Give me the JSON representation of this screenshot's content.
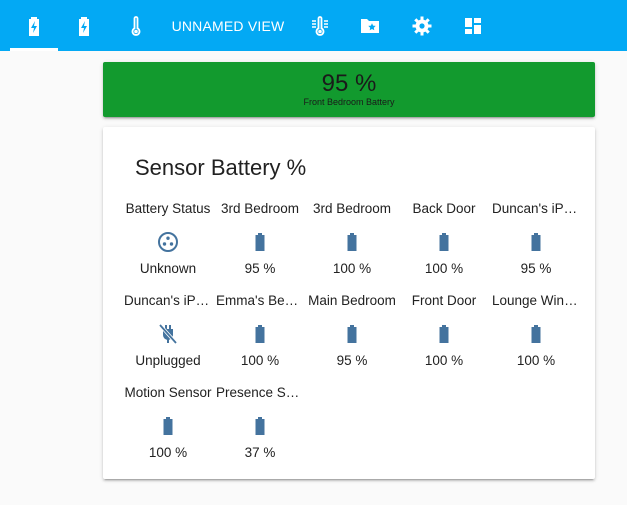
{
  "header": {
    "tabs": [
      {
        "type": "icon",
        "icon": "battery-charging-icon",
        "active": true
      },
      {
        "type": "icon",
        "icon": "battery-charging-icon-2",
        "active": false
      },
      {
        "type": "icon",
        "icon": "thermometer-icon",
        "active": false
      },
      {
        "type": "text",
        "label": "UNNAMED VIEW",
        "active": false
      },
      {
        "type": "icon",
        "icon": "thermometer-lines-icon",
        "active": false
      },
      {
        "type": "icon",
        "icon": "folder-star-icon",
        "active": false
      },
      {
        "type": "icon",
        "icon": "gear-icon",
        "active": false
      },
      {
        "type": "icon",
        "icon": "dashboard-icon",
        "active": false
      }
    ],
    "colors": {
      "bar": "#03a9f4"
    }
  },
  "gauge": {
    "value": "95 %",
    "name": "Front Bedroom Battery",
    "color": "#129a2e"
  },
  "sensors": {
    "title": "Sensor Battery %",
    "icon_color": "#44739e",
    "items": [
      {
        "name": "Battery Status",
        "state": "Unknown",
        "icon": "dots-circle-icon"
      },
      {
        "name": "3rd Bedroom",
        "state": "95 %",
        "icon": "battery-icon"
      },
      {
        "name": "3rd Bedroom",
        "state": "100 %",
        "icon": "battery-icon"
      },
      {
        "name": "Back Door",
        "state": "100 %",
        "icon": "battery-icon"
      },
      {
        "name": "Duncan's iPhone",
        "state": "95 %",
        "icon": "battery-icon"
      },
      {
        "name": "Duncan's iPhone",
        "state": "Unplugged",
        "icon": "power-plug-off-icon"
      },
      {
        "name": "Emma's Bedroom",
        "state": "100 %",
        "icon": "battery-icon"
      },
      {
        "name": "Main Bedroom",
        "state": "95 %",
        "icon": "battery-icon"
      },
      {
        "name": "Front Door",
        "state": "100 %",
        "icon": "battery-icon"
      },
      {
        "name": "Lounge Window",
        "state": "100 %",
        "icon": "battery-icon"
      },
      {
        "name": "Motion Sensor",
        "state": "100 %",
        "icon": "battery-icon"
      },
      {
        "name": "Presence Sensor",
        "state": "37 %",
        "icon": "battery-icon"
      }
    ]
  }
}
